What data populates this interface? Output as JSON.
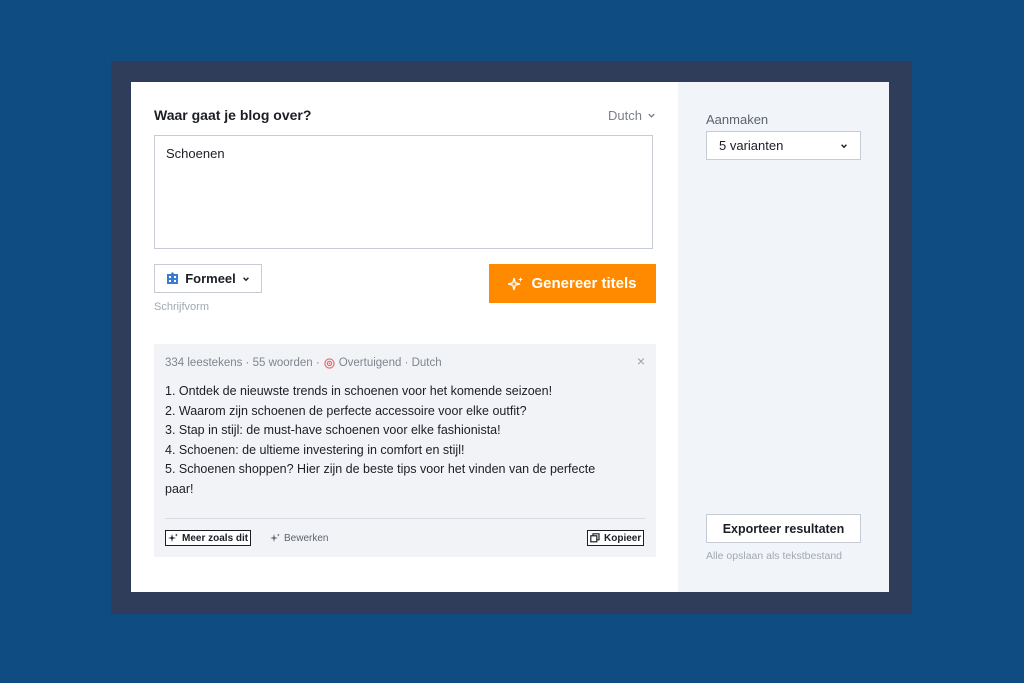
{
  "prompt": {
    "label": "Waar gaat je blog over?",
    "language": "Dutch",
    "topic_value": "Schoenen"
  },
  "tone": {
    "label": "Formeel",
    "caption": "Schrijfvorm"
  },
  "generate_label": "Genereer titels",
  "result": {
    "meta_stats": "334 leestekens · 55 woorden ·",
    "meta_tone": "Overtuigend · Dutch",
    "close": "×",
    "lines": [
      "1. Ontdek de nieuwste trends in schoenen voor het komende seizoen!",
      "2. Waarom zijn schoenen de perfecte accessoire voor elke outfit?",
      "3. Stap in stijl: de must-have schoenen voor elke fashionista!",
      "4. Schoenen: de ultieme investering in comfort en stijl!",
      "5. Schoenen shoppen? Hier zijn de beste tips voor het vinden van de perfecte",
      "paar!"
    ],
    "more_label": "Meer zoals dit",
    "edit_label": "Bewerken",
    "copy_label": "Kopieer"
  },
  "side": {
    "create_label": "Aanmaken",
    "variants_value": "5 varianten",
    "export_label": "Exporteer resultaten",
    "export_caption": "Alle opslaan als tekstbestand"
  },
  "colors": {
    "background": "#0f4c81",
    "frame": "#2f3c5a",
    "accent": "#ff8a00",
    "panel": "#f1f4f8"
  },
  "icons": {
    "language": "chevron-down-icon",
    "tone": "building-icon",
    "generate": "sparkles-icon",
    "meta": "target-icon",
    "close": "close-icon",
    "more": "sparkles-icon",
    "edit": "sparkles-icon",
    "copy": "copy-icon"
  }
}
